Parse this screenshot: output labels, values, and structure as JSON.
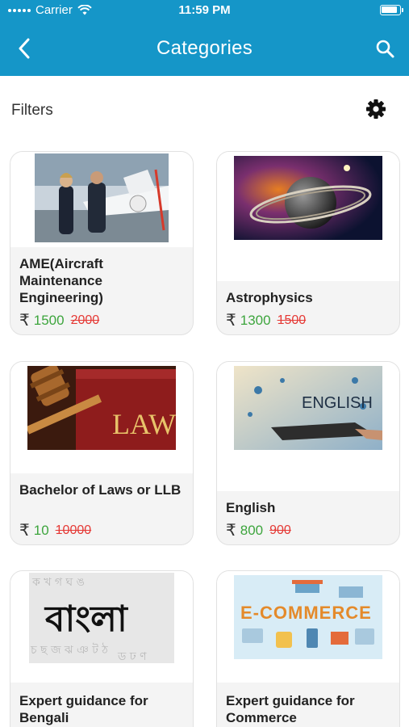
{
  "status": {
    "carrier": "Carrier",
    "time": "11:59 PM"
  },
  "nav": {
    "title": "Categories",
    "back_icon": "chevron-left-icon",
    "search_icon": "search-icon"
  },
  "filters": {
    "label": "Filters",
    "icon": "gear-icon"
  },
  "currency_symbol": "₹",
  "categories": [
    {
      "name": "AME(Aircraft Maintenance Engineering)",
      "price": "1500",
      "original_price": "2000"
    },
    {
      "name": "Astrophysics",
      "price": "1300",
      "original_price": "1500"
    },
    {
      "name": "Bachelor of Laws or LLB",
      "price": "10",
      "original_price": "10000"
    },
    {
      "name": "English",
      "price": "800",
      "original_price": "900"
    },
    {
      "name": "Expert guidance for Bengali"
    },
    {
      "name": "Expert guidance for Commerce"
    }
  ],
  "image_text": {
    "law": "LAW",
    "english": "ENGLISH",
    "bangla": "বাংলা",
    "commerce": "E-COMMERCE"
  },
  "colors": {
    "header": "#1596c8",
    "sale_price": "#3da53d",
    "original_price": "#e53935"
  }
}
